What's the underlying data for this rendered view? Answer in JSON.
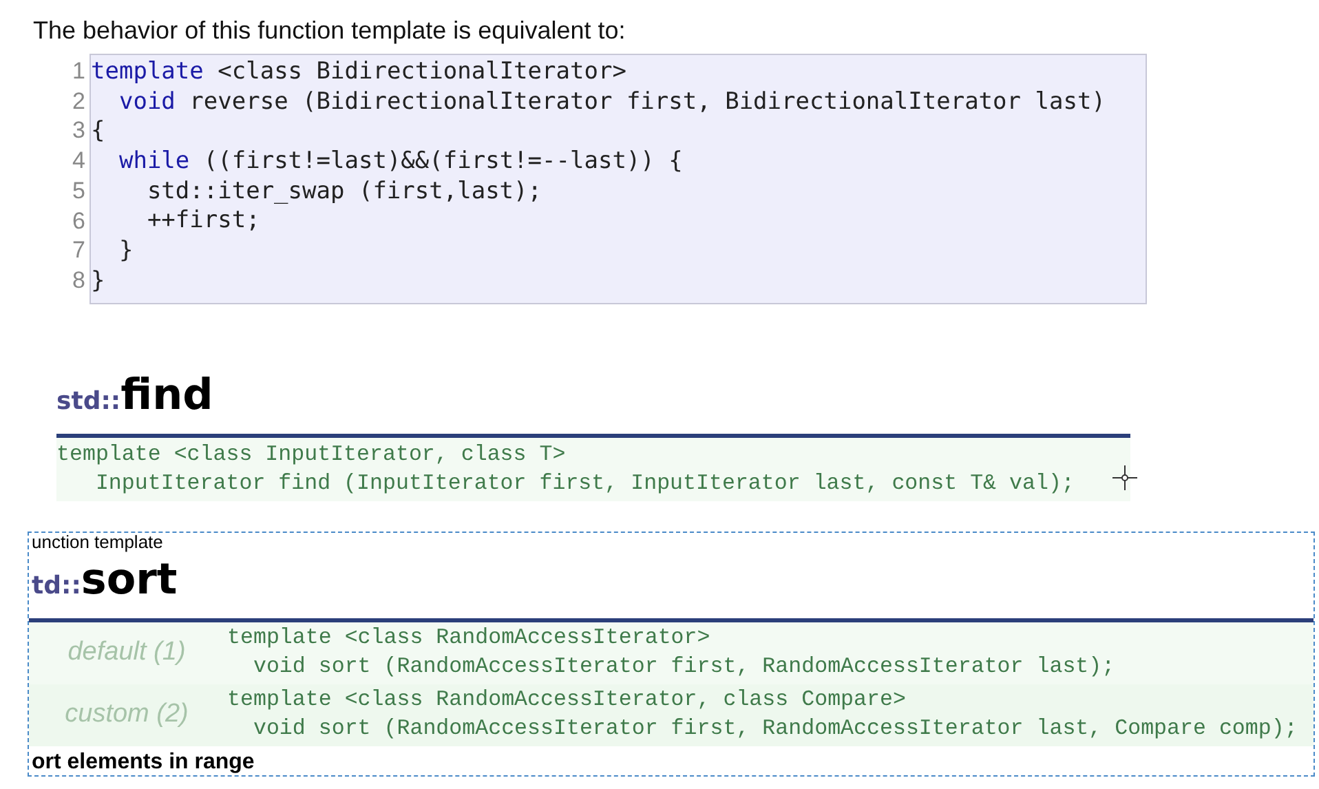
{
  "intro": "The behavior of this function template is equivalent to:",
  "code_block": {
    "lines": [
      {
        "number": "1",
        "segments": [
          {
            "text": "template",
            "kind": "keyword"
          },
          {
            "text": " <class BidirectionalIterator>",
            "kind": "plain"
          }
        ]
      },
      {
        "number": "2",
        "segments": [
          {
            "text": "  void",
            "kind": "keyword"
          },
          {
            "text": " reverse (BidirectionalIterator first, BidirectionalIterator last)",
            "kind": "plain"
          }
        ]
      },
      {
        "number": "3",
        "segments": [
          {
            "text": "{",
            "kind": "plain"
          }
        ]
      },
      {
        "number": "4",
        "segments": [
          {
            "text": "  while",
            "kind": "keyword"
          },
          {
            "text": " ((first!=last)&&(first!=--last)) {",
            "kind": "plain"
          }
        ]
      },
      {
        "number": "5",
        "segments": [
          {
            "text": "    std::iter_swap (first,last);",
            "kind": "plain"
          }
        ]
      },
      {
        "number": "6",
        "segments": [
          {
            "text": "    ++first;",
            "kind": "plain"
          }
        ]
      },
      {
        "number": "7",
        "segments": [
          {
            "text": "  }",
            "kind": "plain"
          }
        ]
      },
      {
        "number": "8",
        "segments": [
          {
            "text": "}",
            "kind": "plain"
          }
        ]
      }
    ]
  },
  "find_section": {
    "prefix": "std::",
    "name": "find",
    "declaration": [
      "template <class InputIterator, class T>",
      "   InputIterator find (InputIterator first, InputIterator last, const T& val);"
    ]
  },
  "sort_section": {
    "clipped_caption": "unction template",
    "prefix": "td::",
    "name": "sort",
    "variants": [
      {
        "label": "default (1)",
        "lines": [
          "template <class RandomAccessIterator>",
          "  void sort (RandomAccessIterator first, RandomAccessIterator last);"
        ]
      },
      {
        "label": "custom (2)",
        "lines": [
          "template <class RandomAccessIterator, class Compare>",
          "  void sort (RandomAccessIterator first, RandomAccessIterator last, Compare comp);"
        ]
      }
    ],
    "clipped_footer": "ort elements in range"
  }
}
